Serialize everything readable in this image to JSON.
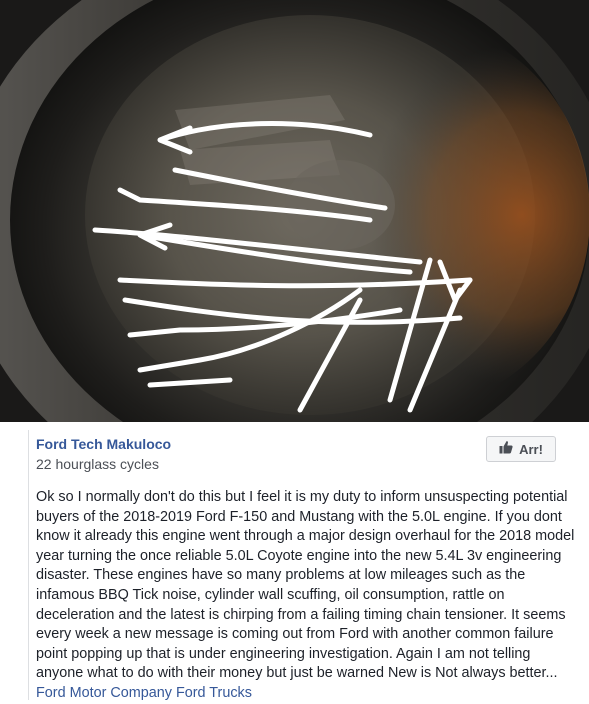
{
  "post": {
    "author": "Ford Tech Makuloco",
    "meta": "22 hourglass cycles",
    "reaction_button": {
      "label": "Arr!",
      "icon": "thumbs-up-icon"
    },
    "body": "Ok so I normally don't do this but I feel it is my duty to inform unsuspecting potential buyers of the 2018-2019 Ford F-150 and Mustang with the 5.0L engine. If you dont know it already this engine went through a major design overhaul for the 2018 model year turning the once reliable 5.0L Coyote engine into the new 5.4L 3v engineering disaster. These engines have so many problems at low mileages such as the infamous BBQ Tick noise, cylinder wall scuffing, oil consumption, rattle on deceleration and the latest is chirping from a failing timing chain tensioner. It seems every week a new message is coming out from Ford with another common failure point popping up that is under engineering investigation. Again I am not telling anyone what to do with their money but just be warned New is Not always better...",
    "links": [
      {
        "label": "Ford Motor Company"
      },
      {
        "label": "Ford Trucks"
      }
    ]
  },
  "photo": {
    "subject": "engine cylinder bore with white hand-drawn arrows",
    "accent_rust": "#a0521c"
  },
  "colors": {
    "link": "#365899",
    "text": "#1d2129",
    "muted": "#4b4f56"
  }
}
